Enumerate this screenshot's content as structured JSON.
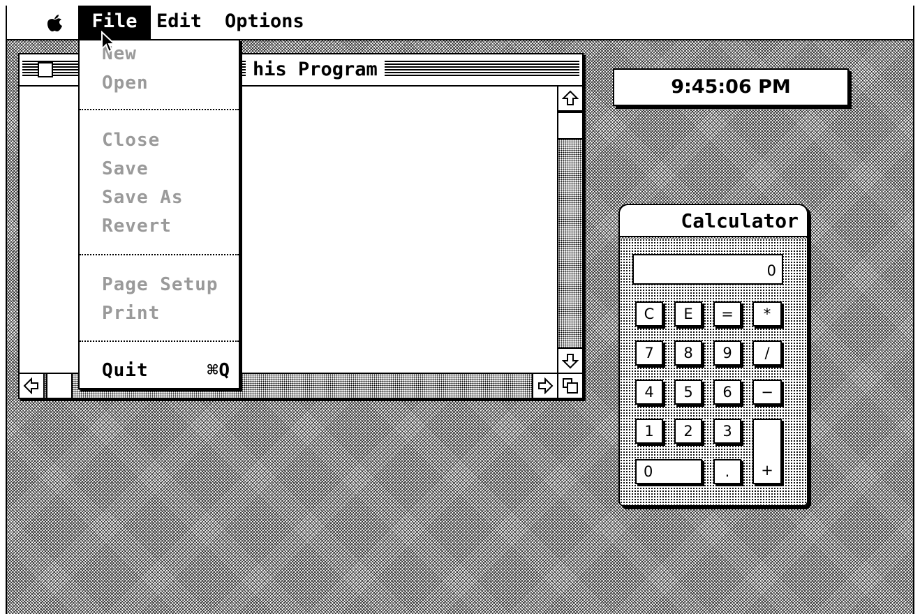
{
  "menubar": {
    "apple": "apple-logo",
    "items": [
      "File",
      "Edit",
      "Options"
    ]
  },
  "file_menu": {
    "items": [
      {
        "label": "New",
        "enabled": false
      },
      {
        "label": "Open",
        "enabled": false
      },
      {
        "label": "Close",
        "enabled": false
      },
      {
        "label": "Save",
        "enabled": false
      },
      {
        "label": "Save As",
        "enabled": false
      },
      {
        "label": "Revert",
        "enabled": false
      },
      {
        "label": "Page Setup",
        "enabled": false
      },
      {
        "label": "Print",
        "enabled": false
      },
      {
        "label": "Quit",
        "enabled": true,
        "shortcut": "⌘Q"
      }
    ]
  },
  "document_window": {
    "title": "his Program"
  },
  "clock": {
    "time": "9:45:06 PM"
  },
  "calculator": {
    "title": "Calculator",
    "display": "0",
    "keys": {
      "c": "C",
      "e": "E",
      "eq": "=",
      "mul": "*",
      "k7": "7",
      "k8": "8",
      "k9": "9",
      "div": "/",
      "k4": "4",
      "k5": "5",
      "k6": "6",
      "sub": "−",
      "k1": "1",
      "k2": "2",
      "k3": "3",
      "add": "+",
      "k0": "0",
      "dot": "."
    }
  }
}
